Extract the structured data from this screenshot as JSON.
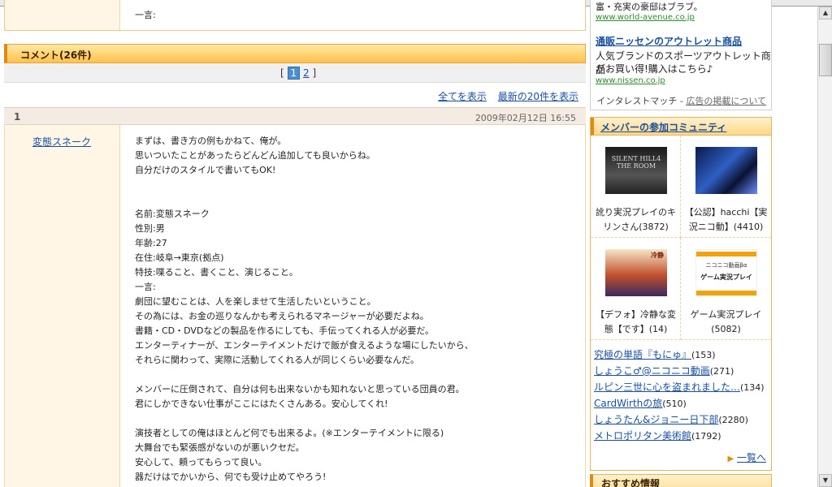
{
  "prev_entry": {
    "label_partial": "一言:"
  },
  "comments": {
    "header": "コメント(26件)",
    "pager": {
      "current": "1",
      "next": "2",
      "open": "[",
      "close": "]"
    },
    "show_all": "全てを表示",
    "show_latest": "最新の20件を表示",
    "entry": {
      "number": "1",
      "date": "2009年02月12日 16:55",
      "author": "変態スネーク",
      "lines": [
        "まずは、書き方の例もかねて、俺が。",
        "思いついたことがあったらどんどん追加しても良いからね。",
        "自分だけのスタイルで書いてもOK!",
        "",
        "",
        "名前:変態スネーク",
        "性別:男",
        "年齢:27",
        "在住:岐阜→東京(拠点)",
        "特技:喋ること、書くこと、演じること。",
        "一言:",
        "劇団に望むことは、人を楽しませて生活したいということ。",
        "その為には、お金の巡りなんかも考えられるマネージャーが必要だよね。",
        "書籍・CD・DVDなどの製品を作るにしても、手伝ってくれる人が必要だ。",
        "エンターティナーが、エンターテイメントだけで飯が食えるような場にしたいから、",
        "それらに関わって、実際に活動してくれる人が同じくらい必要なんだ。",
        "",
        "メンバーに圧倒されて、自分は何も出来ないかも知れないと思っている団員の君。",
        "君にしかできない仕事がここにはたくさんある。安心してくれ!",
        "",
        "演技者としての俺はほとんど何でも出来るよ。(※エンターテイメントに限る)",
        "大舞台でも緊張感がないのが悪いクセだ。",
        "安心して、頼ってもらって良い。",
        "器だけはでかいから、何でも受け止めてやろう!"
      ]
    }
  },
  "ads": {
    "top_desc": "富・充実の豪邸はブラブ。",
    "top_url": "www.world-avenue.co.jp",
    "title": "通販ニッセンのアウトレット商品",
    "desc1": "人気ブランドのスポーツアウトレット商品",
    "desc2": "がお買い得!購入はこちら♪",
    "url": "www.nissen.co.jp",
    "footer_label": "インタレストマッチ -",
    "footer_link": "広告の掲載について"
  },
  "community": {
    "header": "メンバーの参加コミュニティ",
    "grid": [
      {
        "caption": "訛り実況プレイのキリンさん(3872)",
        "thumb_text": "SILENT HILL4 THE ROOM"
      },
      {
        "caption": "【公認】hacchi【実況ニコ動】(4410)",
        "thumb_text": ""
      },
      {
        "caption": "【デフォ】冷静な変態【です】(14)",
        "thumb_text": "冷静"
      },
      {
        "caption": "ゲーム実況プレイ(5082)",
        "thumb_text": "ゲーム実況プレイ",
        "thumb_sub": "ニコニコ動画βα"
      }
    ],
    "list": [
      {
        "name": "究極の単語『もにゅ』",
        "count": "(153)"
      },
      {
        "name": "しょうこ♂@ニコニコ動画",
        "count": "(271)"
      },
      {
        "name": "ルピン三世に心を盗まれました…",
        "count": "(134)"
      },
      {
        "name": "CardWirthの旅",
        "count": "(510)"
      },
      {
        "name": "しょうたん&ジョニー日下部",
        "count": "(2280)"
      },
      {
        "name": "メトロポリタン美術館",
        "count": "(1792)"
      }
    ],
    "more": "一覧へ"
  },
  "recommend": {
    "header": "おすすめ情報"
  },
  "colors": {
    "accent": "#e08a12",
    "link": "#1a4fa0",
    "url_green": "#2d8a2d"
  }
}
